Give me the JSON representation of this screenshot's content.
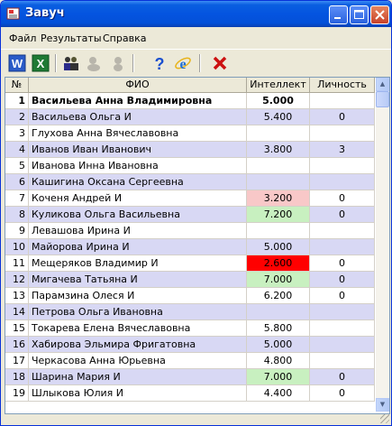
{
  "window": {
    "title": "Завуч"
  },
  "menu": [
    "Файл",
    "Результаты",
    "Справка"
  ],
  "toolbar": [
    {
      "name": "word-icon",
      "glyph": "W",
      "color": "#2a5bc8"
    },
    {
      "name": "excel-icon",
      "glyph": "X",
      "color": "#1f7a34"
    },
    {
      "name": "students-icon",
      "glyph": "👥",
      "color": "#333333"
    },
    {
      "name": "group-disabled-icon",
      "glyph": "●",
      "color": "#b8b5ab"
    },
    {
      "name": "person-disabled-icon",
      "glyph": "●",
      "color": "#b8b5ab"
    },
    {
      "name": "help-icon",
      "glyph": "?",
      "color": "#1a4fcf"
    },
    {
      "name": "internet-explorer-icon",
      "glyph": "e",
      "color": "#1f6fd6"
    },
    {
      "name": "close-x-icon",
      "glyph": "✕",
      "color": "#cc1111"
    }
  ],
  "columns": {
    "num": "№",
    "name": "ФИО",
    "intellect": "Интеллект",
    "personality": "Личность"
  },
  "rows": [
    {
      "num": "1",
      "name": "Васильева Анна Владимировна",
      "intellect": "5.000",
      "personality": "",
      "bold": true
    },
    {
      "num": "2",
      "name": "Васильева Ольга И",
      "intellect": "5.400",
      "personality": "0"
    },
    {
      "num": "3",
      "name": "Глухова Анна Вячеславовна",
      "intellect": "",
      "personality": ""
    },
    {
      "num": "4",
      "name": "Иванов Иван Иванович",
      "intellect": "3.800",
      "personality": "3"
    },
    {
      "num": "5",
      "name": "Иванова Инна Ивановна",
      "intellect": "",
      "personality": ""
    },
    {
      "num": "6",
      "name": "Кашигина Оксана Сергеевна",
      "intellect": "",
      "personality": ""
    },
    {
      "num": "7",
      "name": "Коченя Андрей И",
      "intellect": "3.200",
      "personality": "0",
      "cell_color": "#f8c8c8"
    },
    {
      "num": "8",
      "name": "Куликова Ольга Васильевна",
      "intellect": "7.200",
      "personality": "0",
      "cell_color": "#c8f0c0"
    },
    {
      "num": "9",
      "name": "Левашова Ирина И",
      "intellect": "",
      "personality": ""
    },
    {
      "num": "10",
      "name": "Майорова Ирина И",
      "intellect": "5.000",
      "personality": ""
    },
    {
      "num": "11",
      "name": "Мещеряков Владимир И",
      "intellect": "2.600",
      "personality": "0",
      "cell_color": "#ff0000"
    },
    {
      "num": "12",
      "name": "Мигачева Татьяна И",
      "intellect": "7.000",
      "personality": "0",
      "cell_color": "#c8f0c0"
    },
    {
      "num": "13",
      "name": "Парамзина Олеся И",
      "intellect": "6.200",
      "personality": "0"
    },
    {
      "num": "14",
      "name": "Петрова Ольга Ивановна",
      "intellect": "",
      "personality": ""
    },
    {
      "num": "15",
      "name": "Токарева Елена Вячеславовна",
      "intellect": "5.800",
      "personality": ""
    },
    {
      "num": "16",
      "name": "Хабирова Эльмира Фригатовна",
      "intellect": "5.000",
      "personality": ""
    },
    {
      "num": "17",
      "name": "Черкасова Анна Юрьевна",
      "intellect": "4.800",
      "personality": ""
    },
    {
      "num": "18",
      "name": "Шарина Мария И",
      "intellect": "7.000",
      "personality": "0",
      "cell_color": "#c8f0c0"
    },
    {
      "num": "19",
      "name": "Шлыкова Юлия И",
      "intellect": "4.400",
      "personality": "0"
    }
  ],
  "colors": {
    "stripe": "#d8d8f4",
    "plain": "#ffffff",
    "titlebar": "#0454e0"
  }
}
